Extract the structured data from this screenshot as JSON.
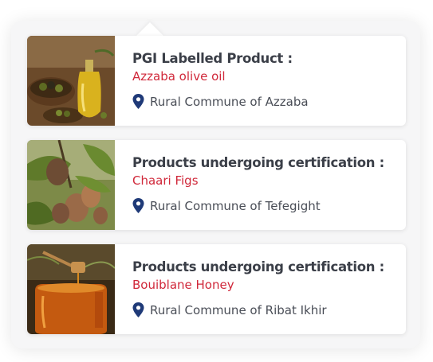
{
  "cards": [
    {
      "title": "PGI Labelled Product :",
      "product": "Azzaba olive oil",
      "location": "Rural Commune of Azzaba",
      "image_icon": "olive-oil-photo"
    },
    {
      "title": "Products undergoing certification :",
      "product": "Chaari Figs",
      "location": "Rural Commune of Tefegight",
      "image_icon": "figs-photo"
    },
    {
      "title": "Products undergoing certification :",
      "product": "Bouiblane Honey",
      "location": "Rural Commune of Ribat Ikhir",
      "image_icon": "honey-photo"
    }
  ],
  "colors": {
    "title": "#3b3f48",
    "product": "#d0283a",
    "pin": "#1f3a78",
    "location": "#4a4e57"
  }
}
